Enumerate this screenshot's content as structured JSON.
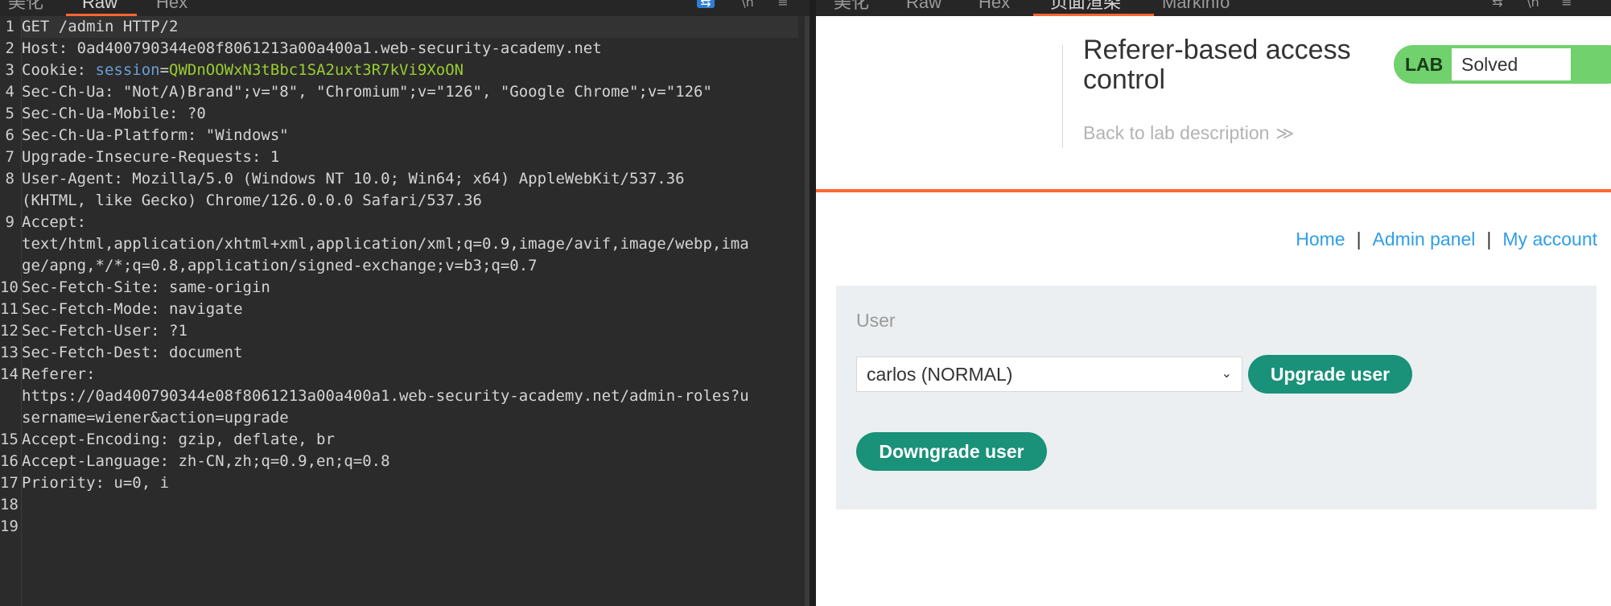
{
  "left_panel": {
    "tabs": [
      {
        "label": "美化",
        "active": false
      },
      {
        "label": "Raw",
        "active": true
      },
      {
        "label": "Hex",
        "active": false
      }
    ],
    "lines": [
      {
        "n": "1",
        "parts": [
          {
            "t": "GET /admin HTTP/2",
            "c": "hname"
          }
        ]
      },
      {
        "n": "2",
        "parts": [
          {
            "t": "Host: ",
            "c": "hname"
          },
          {
            "t": "0ad400790344e08f8061213a00a400a1.web-security-academy.net",
            "c": "hval"
          }
        ]
      },
      {
        "n": "3",
        "parts": [
          {
            "t": "Cookie: ",
            "c": "hname"
          },
          {
            "t": "session",
            "c": "ckey"
          },
          {
            "t": "=",
            "c": "hval"
          },
          {
            "t": "QWDnOOWxN3tBbc1SA2uxt3R7kVi9XoON",
            "c": "cval"
          }
        ]
      },
      {
        "n": "4",
        "parts": [
          {
            "t": "Sec-Ch-Ua: ",
            "c": "hname"
          },
          {
            "t": "\"Not/A)Brand\";v=\"8\", \"Chromium\";v=\"126\", \"Google Chrome\";v=\"126\"",
            "c": "hval"
          }
        ]
      },
      {
        "n": "5",
        "parts": [
          {
            "t": "Sec-Ch-Ua-Mobile: ",
            "c": "hname"
          },
          {
            "t": "?0",
            "c": "hval"
          }
        ]
      },
      {
        "n": "6",
        "parts": [
          {
            "t": "Sec-Ch-Ua-Platform: ",
            "c": "hname"
          },
          {
            "t": "\"Windows\"",
            "c": "hval"
          }
        ]
      },
      {
        "n": "7",
        "parts": [
          {
            "t": "Upgrade-Insecure-Requests: ",
            "c": "hname"
          },
          {
            "t": "1",
            "c": "hval"
          }
        ]
      },
      {
        "n": "8",
        "parts": [
          {
            "t": "User-Agent: ",
            "c": "hname"
          },
          {
            "t": "Mozilla/5.0 (Windows NT 10.0; Win64; x64) AppleWebKit/537.36",
            "c": "hval"
          }
        ]
      },
      {
        "n": "",
        "parts": [
          {
            "t": "(KHTML, like Gecko) Chrome/126.0.0.0 Safari/537.36",
            "c": "hval"
          }
        ]
      },
      {
        "n": "9",
        "parts": [
          {
            "t": "Accept:",
            "c": "hname"
          }
        ]
      },
      {
        "n": "",
        "parts": [
          {
            "t": "text/html,application/xhtml+xml,application/xml;q=0.9,image/avif,image/webp,ima",
            "c": "hval"
          }
        ]
      },
      {
        "n": "",
        "parts": [
          {
            "t": "ge/apng,*/*;q=0.8,application/signed-exchange;v=b3;q=0.7",
            "c": "hval"
          }
        ]
      },
      {
        "n": "10",
        "parts": [
          {
            "t": "Sec-Fetch-Site: ",
            "c": "hname"
          },
          {
            "t": "same-origin",
            "c": "hval"
          }
        ]
      },
      {
        "n": "11",
        "parts": [
          {
            "t": "Sec-Fetch-Mode: ",
            "c": "hname"
          },
          {
            "t": "navigate",
            "c": "hval"
          }
        ]
      },
      {
        "n": "12",
        "parts": [
          {
            "t": "Sec-Fetch-User: ",
            "c": "hname"
          },
          {
            "t": "?1",
            "c": "hval"
          }
        ]
      },
      {
        "n": "13",
        "parts": [
          {
            "t": "Sec-Fetch-Dest: ",
            "c": "hname"
          },
          {
            "t": "document",
            "c": "hval"
          }
        ]
      },
      {
        "n": "14",
        "parts": [
          {
            "t": "Referer:",
            "c": "hname"
          }
        ]
      },
      {
        "n": "",
        "parts": [
          {
            "t": "https://0ad400790344e08f8061213a00a400a1.web-security-academy.net/admin-roles?u",
            "c": "hval"
          }
        ]
      },
      {
        "n": "",
        "parts": [
          {
            "t": "sername=wiener&action=upgrade",
            "c": "hval"
          }
        ]
      },
      {
        "n": "15",
        "parts": [
          {
            "t": "Accept-Encoding: ",
            "c": "hname"
          },
          {
            "t": "gzip, deflate, br",
            "c": "hval"
          }
        ]
      },
      {
        "n": "16",
        "parts": [
          {
            "t": "Accept-Language: ",
            "c": "hname"
          },
          {
            "t": "zh-CN,zh;q=0.9,en;q=0.8",
            "c": "hval"
          }
        ]
      },
      {
        "n": "17",
        "parts": [
          {
            "t": "Priority: ",
            "c": "hname"
          },
          {
            "t": "u=0, i",
            "c": "hval"
          }
        ]
      },
      {
        "n": "18",
        "parts": []
      },
      {
        "n": "19",
        "parts": []
      }
    ]
  },
  "right_panel": {
    "tabs": [
      {
        "label": "美化",
        "active": false
      },
      {
        "label": "Raw",
        "active": false
      },
      {
        "label": "Hex",
        "active": false
      },
      {
        "label": "页面渲染",
        "active": true
      },
      {
        "label": "Markinfo",
        "active": false
      }
    ],
    "lab_title": "Referer-based access control",
    "back_link": "Back to lab description",
    "back_chevron": "≫",
    "lab_badge": {
      "label": "LAB",
      "status": "Solved"
    },
    "nav": [
      {
        "label": "Home"
      },
      {
        "label": "Admin panel"
      },
      {
        "label": "My account"
      }
    ],
    "nav_separator": "|",
    "admin": {
      "user_label": "User",
      "selected_user": "carlos (NORMAL)",
      "upgrade_button": "Upgrade user",
      "downgrade_button": "Downgrade user"
    }
  },
  "colors": {
    "accent_orange": "#ff6633",
    "lab_green": "#70d16d",
    "button_teal": "#1a9179",
    "link_blue": "#2f9ee8",
    "cookie_value_green": "#9acd32",
    "cookie_key_blue": "#6a9fd8"
  }
}
